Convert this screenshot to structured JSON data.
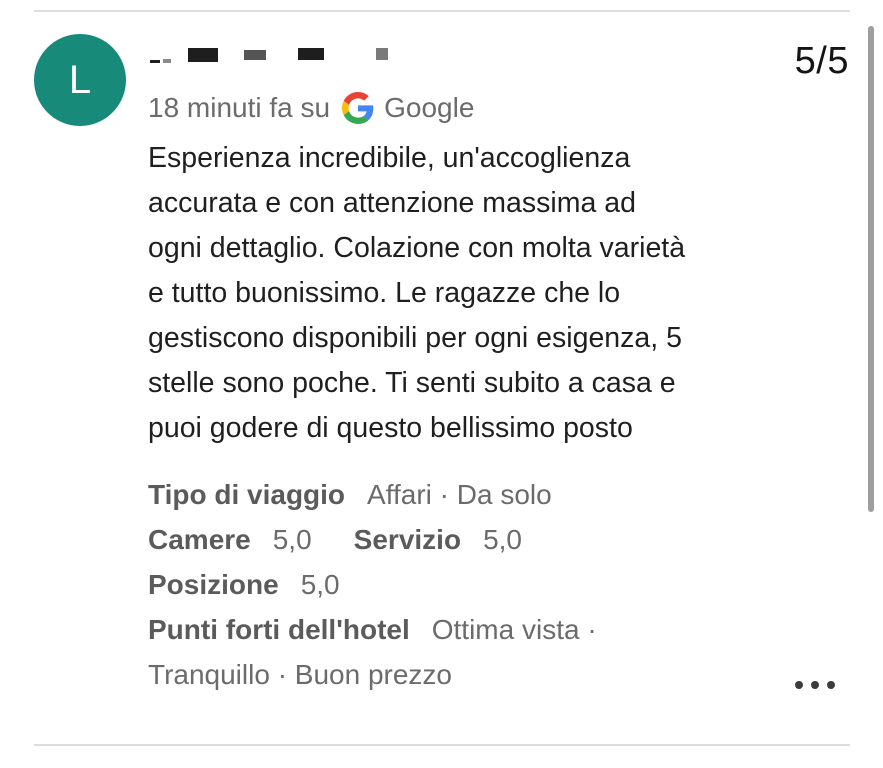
{
  "review": {
    "avatar_initial": "L",
    "avatar_color": "#178a7a",
    "rating": "5/5",
    "time_source": "18 minuti fa su",
    "source_icon": "google-g-icon",
    "source_name": "Google",
    "text_lines": [
      "Esperienza incredibile, un'accoglienza",
      "accurata e con attenzione massima ad",
      "ogni dettaglio. Colazione con molta varietà",
      "e tutto buonissimo. Le ragazze che lo",
      "gestiscono disponibili per ogni esigenza, 5",
      "stelle sono poche. Ti senti subito a casa e",
      "puoi godere di questo bellissimo posto"
    ],
    "details": {
      "trip_type_label": "Tipo di viaggio",
      "trip_type_value": "Affari · Da solo",
      "rooms_label": "Camere",
      "rooms_value": "5,0",
      "service_label": "Servizio",
      "service_value": "5,0",
      "location_label": "Posizione",
      "location_value": "5,0",
      "highlights_label": "Punti forti dell'hotel",
      "highlights_value_line1": "Ottima vista ·",
      "highlights_value_line2": "Tranquillo · Buon prezzo"
    },
    "more_icon": "more-horizontal-icon"
  }
}
